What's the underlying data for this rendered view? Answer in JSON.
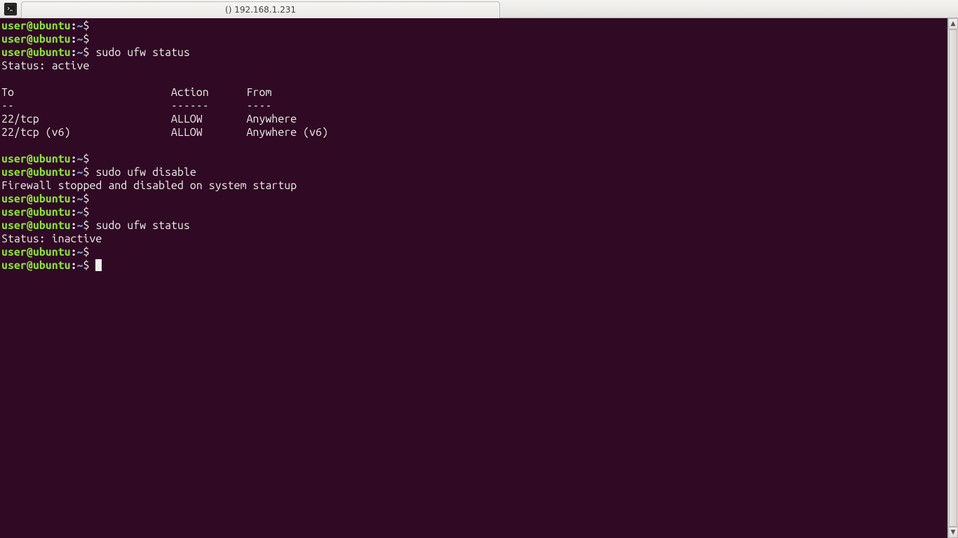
{
  "window": {
    "title": "() 192.168.1.231"
  },
  "prompt": {
    "user": "user",
    "at": "@",
    "host": "ubuntu",
    "colon": ":",
    "path": "~",
    "dollar": "$"
  },
  "lines": [
    {
      "type": "prompt",
      "cmd": ""
    },
    {
      "type": "prompt",
      "cmd": ""
    },
    {
      "type": "prompt",
      "cmd": "sudo ufw status"
    },
    {
      "type": "output",
      "text": "Status: active"
    },
    {
      "type": "blank"
    },
    {
      "type": "output",
      "text": "To                         Action      From"
    },
    {
      "type": "output",
      "text": "--                         ------      ----"
    },
    {
      "type": "output",
      "text": "22/tcp                     ALLOW       Anywhere"
    },
    {
      "type": "output",
      "text": "22/tcp (v6)                ALLOW       Anywhere (v6)"
    },
    {
      "type": "blank"
    },
    {
      "type": "prompt",
      "cmd": ""
    },
    {
      "type": "prompt",
      "cmd": "sudo ufw disable"
    },
    {
      "type": "output",
      "text": "Firewall stopped and disabled on system startup"
    },
    {
      "type": "prompt",
      "cmd": ""
    },
    {
      "type": "prompt",
      "cmd": ""
    },
    {
      "type": "prompt",
      "cmd": "sudo ufw status"
    },
    {
      "type": "output",
      "text": "Status: inactive"
    },
    {
      "type": "prompt",
      "cmd": ""
    },
    {
      "type": "prompt",
      "cmd": "",
      "cursor": true
    }
  ],
  "scrollbar": {
    "up": "▲",
    "down": "▼"
  }
}
